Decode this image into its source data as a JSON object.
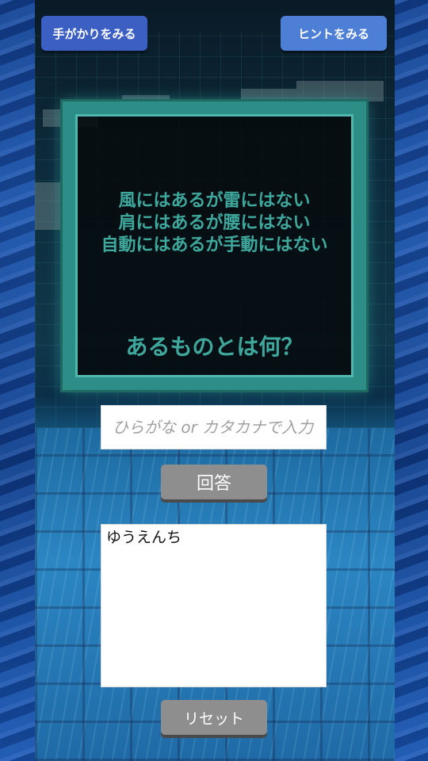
{
  "header": {
    "clue_button_label": "手がかりをみる",
    "hint_button_label": "ヒントをみる"
  },
  "puzzle": {
    "riddle_lines": [
      "風にはあるが雷にはない",
      "肩にはあるが腰にはない",
      "自動にはあるが手動にはない"
    ],
    "question": "あるものとは何？"
  },
  "answer": {
    "placeholder": "ひらがな or カタカナで入力",
    "value": ""
  },
  "submit_button_label": "回答",
  "history": {
    "entries": [
      "ゆうえんち"
    ]
  },
  "reset_button_label": "リセット",
  "colors": {
    "panel_border": "#2c8e86",
    "riddle_text": "#3fa89d",
    "clue_button": "#3c5fc4",
    "hint_button": "#4d7fd6",
    "gray_button": "#8e8e8e"
  }
}
